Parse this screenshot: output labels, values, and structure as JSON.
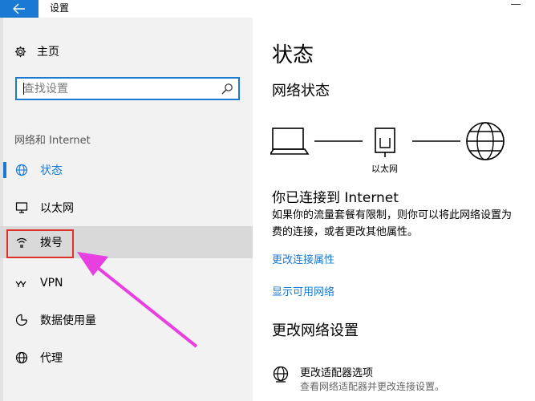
{
  "window": {
    "title": "设置"
  },
  "sidebar": {
    "home_label": "主页",
    "search_placeholder": "查找设置",
    "section_label": "网络和 Internet",
    "items": [
      {
        "label": "状态",
        "icon": "globe-icon"
      },
      {
        "label": "以太网",
        "icon": "monitor-icon"
      },
      {
        "label": "拨号",
        "icon": "dialup-icon"
      },
      {
        "label": "VPN",
        "icon": "vpn-icon"
      },
      {
        "label": "数据使用量",
        "icon": "data-usage-icon"
      },
      {
        "label": "代理",
        "icon": "globe-icon"
      }
    ]
  },
  "main": {
    "title": "状态",
    "network_status_heading": "网络状态",
    "ethernet_label": "以太网",
    "connected_text": "你已连接到 Internet",
    "description_line1": "如果你的流量套餐有限制，则你可以将此网络设置为",
    "description_line2": "费的连接，或者更改其他属性。",
    "link_change_properties": "更改连接属性",
    "link_show_networks": "显示可用网络",
    "change_settings_heading": "更改网络设置",
    "adapter_title": "更改适配器选项",
    "adapter_subtitle": "查看网络适配器并更改连接设置。"
  },
  "colors": {
    "accent": "#1979d3",
    "highlight_box": "#e0302a",
    "annotation_arrow": "#e83fe0"
  }
}
